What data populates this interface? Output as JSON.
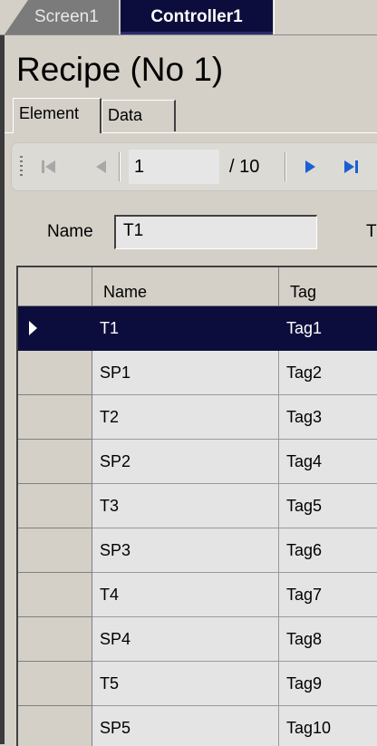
{
  "tabs": {
    "screen": "Screen1",
    "controller": "Controller1"
  },
  "title": "Recipe (No 1)",
  "sub_tabs": {
    "element": "Element",
    "data": "Data"
  },
  "navigator": {
    "position": "1",
    "count": "/ 10"
  },
  "name_field": {
    "label": "Name",
    "value": "T1",
    "next_label": "T"
  },
  "grid": {
    "headers": {
      "name": "Name",
      "tag": "Tag"
    },
    "rows": [
      {
        "name": "T1",
        "tag": "Tag1",
        "selected": true
      },
      {
        "name": "SP1",
        "tag": "Tag2"
      },
      {
        "name": "T2",
        "tag": "Tag3"
      },
      {
        "name": "SP2",
        "tag": "Tag4"
      },
      {
        "name": "T3",
        "tag": "Tag5"
      },
      {
        "name": "SP3",
        "tag": "Tag6"
      },
      {
        "name": "T4",
        "tag": "Tag7"
      },
      {
        "name": "SP4",
        "tag": "Tag8"
      },
      {
        "name": "T5",
        "tag": "Tag9"
      },
      {
        "name": "SP5",
        "tag": "Tag10"
      }
    ]
  },
  "colors": {
    "selection": "#0d0d3d",
    "accent": "#1a5fd4",
    "face": "#d4d0c8"
  }
}
